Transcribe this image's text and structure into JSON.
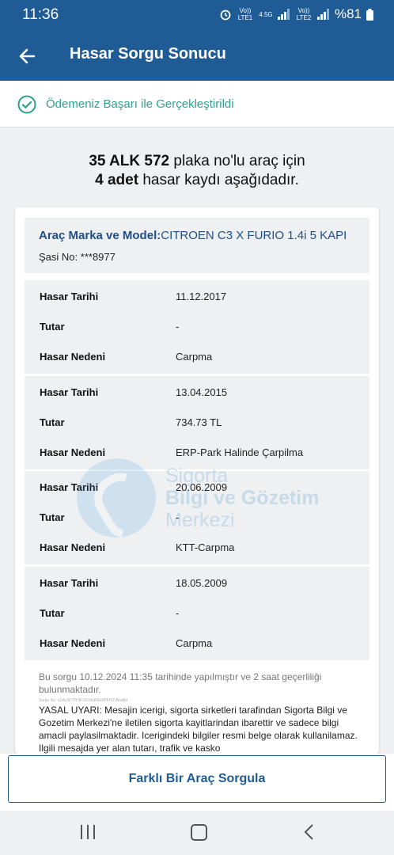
{
  "status_bar": {
    "time": "11:36",
    "sim1_label": "Vo)) LTE1",
    "network_type": "4.5G",
    "sim2_label": "Vo)) LTE2",
    "battery": "%81"
  },
  "app_bar": {
    "title": "Hasar Sorgu Sonucu"
  },
  "success_banner": {
    "text": "Ödemeniz Başarı ile Gerçekleştirildi"
  },
  "summary": {
    "plate": "35 ALK 572",
    "plate_suffix": " plaka no'lu araç için",
    "count": "4 adet",
    "count_suffix": " hasar kaydı aşağıdadır."
  },
  "vehicle": {
    "model_label": "Araç Marka ve Model:",
    "model_value": "CITROEN C3 X FURIO 1.4i 5 KAPI",
    "chassis_label": "Şasi No:",
    "chassis_value": "***8977"
  },
  "labels": {
    "date": "Hasar Tarihi",
    "amount": "Tutar",
    "reason": "Hasar Nedeni"
  },
  "records": [
    {
      "date": "11.12.2017",
      "amount": "-",
      "reason": "Carpma"
    },
    {
      "date": "13.04.2015",
      "amount": "734.73 TL",
      "reason": "ERP-Park Halinde Çarpilma"
    },
    {
      "date": "20.06.2009",
      "amount": "-",
      "reason": "KTT-Carpma"
    },
    {
      "date": "18.05.2009",
      "amount": "-",
      "reason": "Carpma"
    }
  ],
  "watermark": {
    "line1": "Sigorta",
    "line2": "Bilgi ve Gözetim",
    "line3": "Merkezi"
  },
  "footer": {
    "query_note": "Bu sorgu 10.12.2024 11:35 tarihinde yapılmıştır ve 2 saat geçerliliği bulunmaktadır.",
    "tiny_code": "Sorgu No: a1Ay3DTtY9FGDr9uRtEt0Pfr6fZ-Bndfpf",
    "legal_text": "YASAL UYARI: Mesajin icerigi, sigorta sirketleri tarafindan Sigorta Bilgi ve Gozetim Merkezi'ne iletilen sigorta kayitlarindan ibarettir ve sadece bilgi amacli paylasilmaktadir. Icerigindeki bilgiler resmi belge olarak kullanilamaz. Ilgili mesajda yer alan tutarı, trafik ve kasko"
  },
  "actions": {
    "new_query_button": "Farklı Bir Araç Sorgula"
  },
  "colors": {
    "primary": "#1f5c96",
    "success": "#2e9e8f",
    "background": "#eef0f2"
  },
  "icons": {
    "back": "arrow-left-icon",
    "success": "check-circle-icon",
    "recent_apps": "recent-apps-icon",
    "home": "home-icon",
    "nav_back": "chevron-left-icon"
  }
}
